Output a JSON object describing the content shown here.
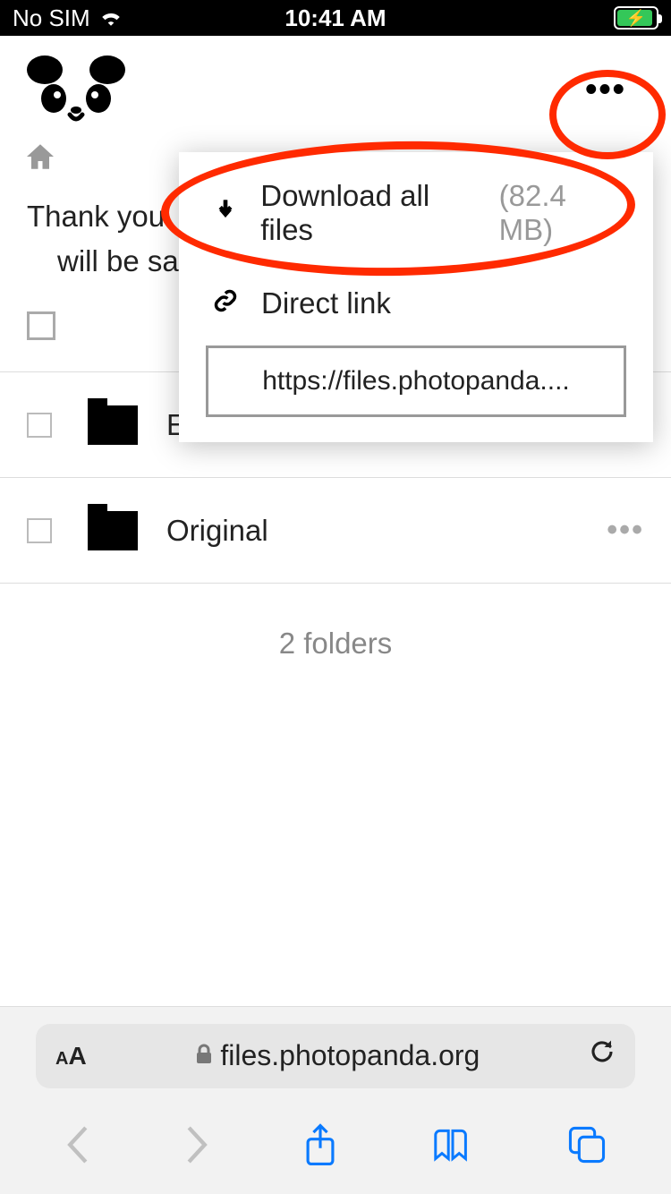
{
  "status": {
    "carrier": "No SIM",
    "time": "10:41 AM"
  },
  "popup": {
    "download_label": "Download all files",
    "download_size": "(82.4 MB)",
    "direct_link_label": "Direct link",
    "direct_link_url": "https://files.photopanda...."
  },
  "notice_line1": "Thank you",
  "notice_line2": "will be sa",
  "folders": [
    {
      "name": "Enhanced"
    },
    {
      "name": "Original"
    }
  ],
  "summary": "2 folders",
  "address_bar": {
    "domain": "files.photopanda.org"
  }
}
